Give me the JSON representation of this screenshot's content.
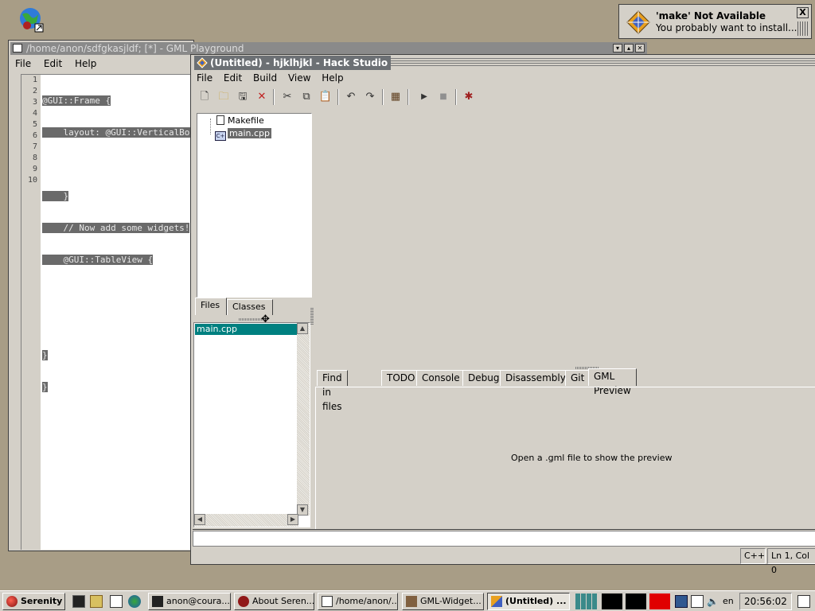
{
  "desktop": {
    "icon": "globe-icon"
  },
  "notification": {
    "title": "'make' Not Available",
    "body": "You probably want to install...",
    "close_label": "X",
    "icon": "hack-studio-icon"
  },
  "gml_window": {
    "title": "/home/anon/sdfgkasjldf; [*] - GML Playground",
    "menu": [
      "File",
      "Edit",
      "Help"
    ],
    "line_numbers": [
      "1",
      "2",
      "3",
      "4",
      "5",
      "6",
      "7",
      "8",
      "9",
      "10"
    ],
    "code_lines": [
      "@GUI::Frame {",
      "    layout: @GUI::VerticalBox",
      "",
      "    }",
      "    // Now add some widgets!",
      "    @GUI::TableView {",
      "",
      "",
      "}",
      "}"
    ]
  },
  "hack_studio": {
    "title": "(Untitled) - hjklhjkl - Hack Studio",
    "menu": [
      "File",
      "Edit",
      "Build",
      "View",
      "Help"
    ],
    "toolbar_icons": [
      "new-file-icon",
      "open-folder-icon",
      "save-icon",
      "delete-icon",
      "cut-icon",
      "copy-icon",
      "paste-icon",
      "undo-icon",
      "redo-icon",
      "build-icon",
      "run-icon",
      "stop-icon",
      "debug-icon"
    ],
    "project_tree": [
      {
        "label": "Makefile",
        "icon": "file-icon",
        "selected": false
      },
      {
        "label": "main.cpp",
        "icon": "cpp-file-icon",
        "selected": true
      }
    ],
    "left_tabs": [
      "Files",
      "Classes"
    ],
    "open_files": [
      "main.cpp"
    ],
    "bottom_tabs": [
      "Find in files",
      "TODO",
      "Console",
      "Debug",
      "Disassembly",
      "Git",
      "GML Preview"
    ],
    "active_bottom_tab": "GML Preview",
    "preview_message": "Open a .gml file to show the preview",
    "status": {
      "language": "C++",
      "position": "Ln 1, Col 0"
    }
  },
  "taskbar": {
    "start_label": "Serenity",
    "quick_launch": [
      "terminal-icon",
      "file-manager-icon",
      "text-editor-icon",
      "browser-icon"
    ],
    "windows": [
      {
        "label": "anon@coura...",
        "icon": "terminal-icon",
        "active": false
      },
      {
        "label": "About Seren...",
        "icon": "serenity-icon",
        "active": false
      },
      {
        "label": "/home/anon/...",
        "icon": "gml-icon",
        "active": false
      },
      {
        "label": "GML-Widget...",
        "icon": "hammer-icon",
        "active": false
      },
      {
        "label": "(Untitled) ...",
        "icon": "hack-studio-icon",
        "active": true
      }
    ],
    "language": "en",
    "clock": "20:56:02"
  }
}
